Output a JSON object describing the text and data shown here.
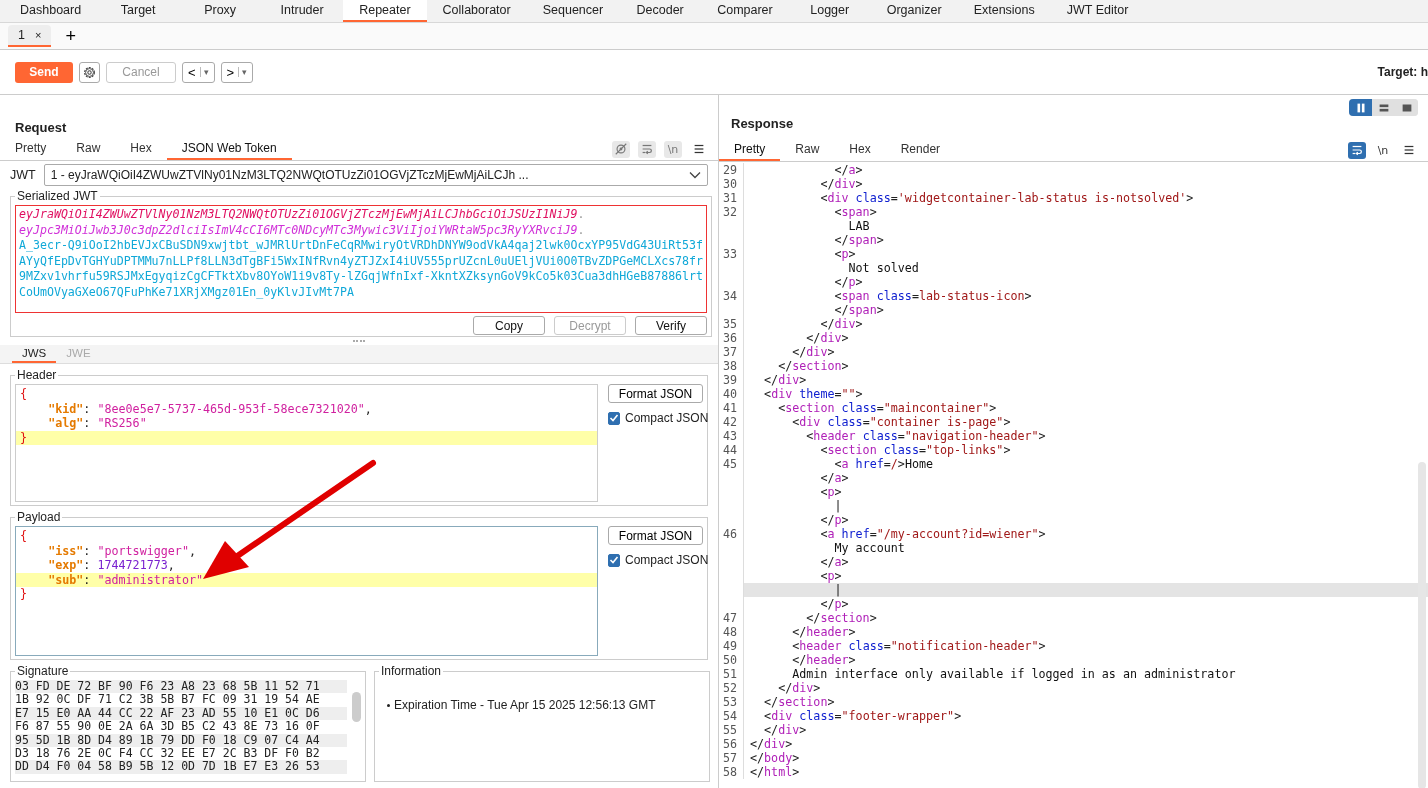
{
  "main_tabs": [
    {
      "label": "Dashboard",
      "selected": false
    },
    {
      "label": "Target",
      "selected": false
    },
    {
      "label": "Proxy",
      "selected": false
    },
    {
      "label": "Intruder",
      "selected": false
    },
    {
      "label": "Repeater",
      "selected": true
    },
    {
      "label": "Collaborator",
      "selected": false
    },
    {
      "label": "Sequencer",
      "selected": false
    },
    {
      "label": "Decoder",
      "selected": false
    },
    {
      "label": "Comparer",
      "selected": false
    },
    {
      "label": "Logger",
      "selected": false
    },
    {
      "label": "Organizer",
      "selected": false
    },
    {
      "label": "Extensions",
      "selected": false
    },
    {
      "label": "JWT Editor",
      "selected": false
    }
  ],
  "repeater_tabs": [
    {
      "label": "1",
      "close": "×",
      "selected": true
    }
  ],
  "new_tab": "+",
  "toolbar": {
    "send": "Send",
    "cancel": {
      "label": "Cancel",
      "disabled": true
    },
    "history": [
      {
        "arrow": "<",
        "caret": "▾"
      },
      {
        "arrow": ">",
        "caret": "▾"
      }
    ],
    "target": "Target: h"
  },
  "request": {
    "title": "Request",
    "tabs": [
      {
        "label": "Pretty",
        "selected": false
      },
      {
        "label": "Raw",
        "selected": false
      },
      {
        "label": "Hex",
        "selected": false
      },
      {
        "label": "JSON Web Token",
        "selected": true
      }
    ],
    "icons": [
      {
        "kind": "hide"
      },
      {
        "kind": "wrap"
      },
      {
        "kind": "newline",
        "label": "\\n"
      },
      {
        "kind": "menu"
      }
    ],
    "jwt_selector": {
      "label": "JWT",
      "value": "1 - eyJraWQiOiI4ZWUwZTVlNy01NzM3LTQ2NWQtOTUzZi01OGVjZTczMjEwMjAiLCJh ..."
    },
    "serialized": {
      "legend": "Serialized JWT",
      "parts": [
        {
          "kind": "header",
          "text": "eyJraWQiOiI4ZWUwZTVlNy01NzM3LTQ2NWQtOTUzZi01OGVjZTczMjEwMjAiLCJhbGciOiJSUzI1NiJ9",
          "separator": "."
        },
        {
          "kind": "payload",
          "text": "eyJpc3MiOiJwb3J0c3dpZ2dlciIsImV4cCI6MTc0NDcyMTc3Mywic3ViIjoiYWRtaW5pc3RyYXRvciJ9",
          "separator": "."
        },
        {
          "kind": "signature",
          "text": "A_3ecr-Q9iOoI2hbEVJxCBuSDN9xwjtbt_wJMRlUrtDnFeCqRMwiryOtVRDhDNYW9odVkA4qaj2lwk0OcxYP95VdG43UiRt53fAYyQfEpDvTGHYuDPTMMu7nLLPf8LLN3dTgBFi5WxINfRvn4yZTJZxI4iUV555prUZcnL0uUEljVUi0O0TBvZDPGeMCLXcs78fr9MZxv1vhrfu59RSJMxEgyqizCgCFTktXbv8OYoW1i9v8Ty-lZGqjWfnIxf-XkntXZksynGoV9kCo5k03Cua3dhHGeB87886lrtCoUmOVyaGXeO67QFuPhKe71XRjXMgz01En_0yKlvJIvMt7PA"
        }
      ],
      "buttons": [
        {
          "label": "Copy",
          "disabled": false
        },
        {
          "label": "Decrypt",
          "disabled": true
        },
        {
          "label": "Verify",
          "disabled": false
        }
      ]
    },
    "token_tabs": [
      {
        "label": "JWS",
        "selected": true,
        "disabled": false
      },
      {
        "label": "JWE",
        "selected": false,
        "disabled": true
      }
    ],
    "header_section": {
      "legend": "Header",
      "lines": [
        {
          "code": "{",
          "highlighted": false
        },
        {
          "code": "    \"kid\": \"8ee0e5e7-5737-465d-953f-58ece7321020\",",
          "highlighted": false
        },
        {
          "code": "    \"alg\": \"RS256\"",
          "highlighted": false
        },
        {
          "code": "}",
          "highlighted": true
        }
      ],
      "format_button": "Format JSON",
      "compact": {
        "label": "Compact JSON",
        "checked": true
      }
    },
    "payload_section": {
      "legend": "Payload",
      "lines": [
        {
          "code": "{",
          "highlighted": false
        },
        {
          "code": "    \"iss\": \"portswigger\",",
          "highlighted": false
        },
        {
          "code": "    \"exp\": 1744721773,",
          "highlighted": false
        },
        {
          "code": "    \"sub\": \"administrator\"",
          "highlighted": true
        },
        {
          "code": "}",
          "highlighted": false
        }
      ],
      "format_button": "Format JSON",
      "compact": {
        "label": "Compact JSON",
        "checked": true
      }
    },
    "signature": {
      "legend": "Signature",
      "rows": [
        "03 FD DE 72 BF 90 F6 23 A8 23 68 5B 11 52 71",
        "1B 92 0C DF 71 C2 3B 5B B7 FC 09 31 19 54 AE",
        "E7 15 E0 AA 44 CC 22 AF 23 AD 55 10 E1 0C D6",
        "F6 87 55 90 0E 2A 6A 3D B5 C2 43 8E 73 16 0F",
        "95 5D 1B 8D D4 89 1B 79 DD F0 18 C9 07 C4 A4",
        "D3 18 76 2E 0C F4 CC 32 EE E7 2C B3 DF F0 B2",
        "DD D4 F0 04 58 B9 5B 12 0D 7D 1B E7 E3 26 53"
      ]
    },
    "information": {
      "legend": "Information",
      "items": [
        "Expiration Time - Tue Apr 15 2025 12:56:13 GMT"
      ]
    },
    "annotation": {
      "kind": "arrow"
    }
  },
  "response": {
    "view_modes": [
      {
        "kind": "split",
        "selected": true
      },
      {
        "kind": "rows",
        "selected": false
      },
      {
        "kind": "single",
        "selected": false
      }
    ],
    "title": "Response",
    "tabs": [
      {
        "label": "Pretty",
        "selected": true
      },
      {
        "label": "Raw",
        "selected": false
      },
      {
        "label": "Hex",
        "selected": false
      },
      {
        "label": "Render",
        "selected": false
      }
    ],
    "icons": [
      {
        "kind": "wrap",
        "selected": true
      },
      {
        "kind": "newline",
        "label": "\\n",
        "selected": false
      },
      {
        "kind": "menu",
        "selected": false
      }
    ],
    "lines": [
      {
        "n": "29",
        "code": "            </a>",
        "highlighted": false
      },
      {
        "n": "30",
        "code": "          </div>",
        "highlighted": false
      },
      {
        "n": "31",
        "code": "          <div class='widgetcontainer-lab-status is-notsolved'>",
        "highlighted": false
      },
      {
        "n": "32",
        "code": "            <span>",
        "highlighted": false
      },
      {
        "code": "              LAB",
        "highlighted": false
      },
      {
        "code": "            </span>",
        "highlighted": false
      },
      {
        "n": "33",
        "code": "            <p>",
        "highlighted": false
      },
      {
        "code": "              Not solved",
        "highlighted": false
      },
      {
        "code": "            </p>",
        "highlighted": false
      },
      {
        "n": "34",
        "code": "            <span class=lab-status-icon>",
        "highlighted": false
      },
      {
        "code": "            </span>",
        "highlighted": false
      },
      {
        "n": "35",
        "code": "          </div>",
        "highlighted": false
      },
      {
        "n": "36",
        "code": "        </div>",
        "highlighted": false
      },
      {
        "n": "37",
        "code": "      </div>",
        "highlighted": false
      },
      {
        "n": "38",
        "code": "    </section>",
        "highlighted": false
      },
      {
        "n": "39",
        "code": "  </div>",
        "highlighted": false
      },
      {
        "n": "40",
        "code": "  <div theme=\"\">",
        "highlighted": false
      },
      {
        "n": "41",
        "code": "    <section class=\"maincontainer\">",
        "highlighted": false
      },
      {
        "n": "42",
        "code": "      <div class=\"container is-page\">",
        "highlighted": false
      },
      {
        "n": "43",
        "code": "        <header class=\"navigation-header\">",
        "highlighted": false
      },
      {
        "n": "44",
        "code": "          <section class=\"top-links\">",
        "highlighted": false
      },
      {
        "n": "45",
        "code": "            <a href=/>Home",
        "highlighted": false
      },
      {
        "code": "          </a>",
        "highlighted": false
      },
      {
        "code": "          <p>",
        "highlighted": false
      },
      {
        "code": "            |",
        "highlighted": false
      },
      {
        "code": "          </p>",
        "highlighted": false
      },
      {
        "n": "46",
        "code": "          <a href=\"/my-account?id=wiener\">",
        "highlighted": false
      },
      {
        "code": "            My account",
        "highlighted": false
      },
      {
        "code": "          </a>",
        "highlighted": false
      },
      {
        "code": "          <p>",
        "highlighted": false
      },
      {
        "code": "            |",
        "highlighted": true
      },
      {
        "code": "          </p>",
        "highlighted": false
      },
      {
        "n": "47",
        "code": "        </section>",
        "highlighted": false
      },
      {
        "n": "48",
        "code": "      </header>",
        "highlighted": false
      },
      {
        "n": "49",
        "code": "      <header class=\"notification-header\">",
        "highlighted": false
      },
      {
        "n": "50",
        "code": "      </header>",
        "highlighted": false
      },
      {
        "n": "51",
        "code": "      Admin interface only available if logged in as an administrator",
        "highlighted": false
      },
      {
        "n": "52",
        "code": "    </div>",
        "highlighted": false
      },
      {
        "n": "53",
        "code": "  </section>",
        "highlighted": false
      },
      {
        "n": "54",
        "code": "  <div class=\"footer-wrapper\">",
        "highlighted": false
      },
      {
        "n": "55",
        "code": "  </div>",
        "highlighted": false
      },
      {
        "n": "56",
        "code": "</div>",
        "highlighted": false
      },
      {
        "n": "57",
        "code": "</body>",
        "highlighted": false
      },
      {
        "n": "58",
        "code": "</html>",
        "highlighted": false
      }
    ]
  }
}
